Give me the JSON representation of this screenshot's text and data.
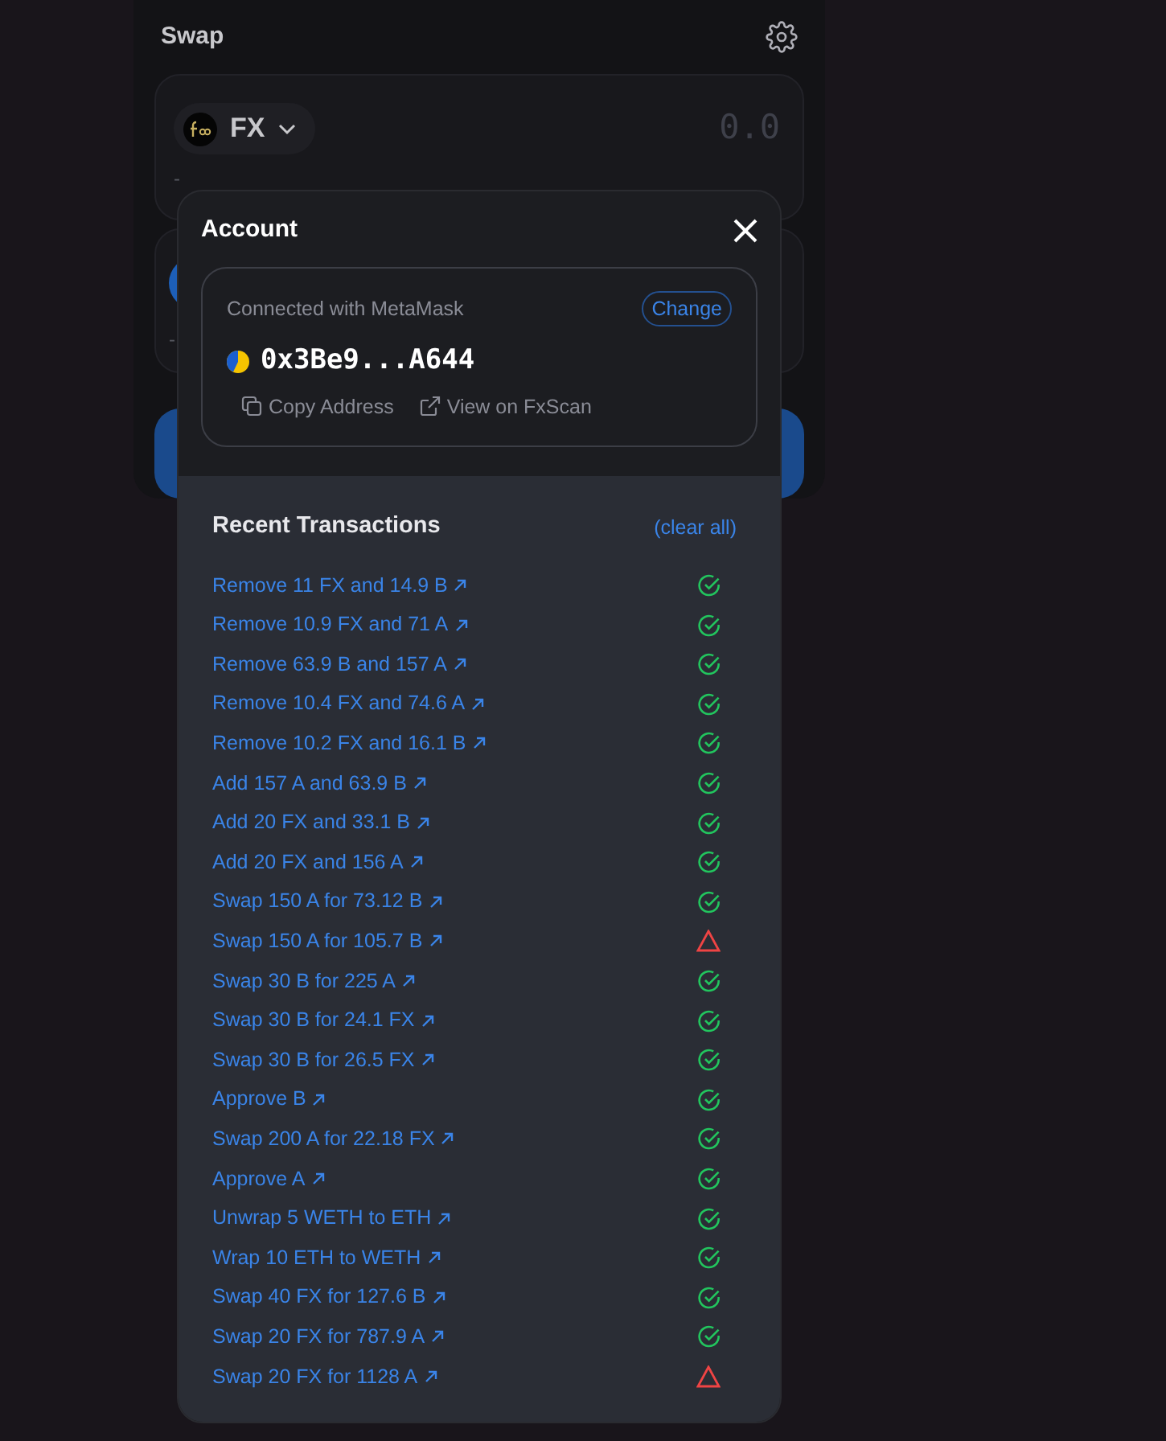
{
  "swap": {
    "title": "Swap",
    "input": {
      "token": "FX",
      "value": "0.0",
      "balance": "-"
    },
    "output": {
      "balance": "-"
    }
  },
  "account": {
    "title": "Account",
    "connected_with": "Connected with MetaMask",
    "change_label": "Change",
    "address": "0x3Be9...A644",
    "copy_label": "Copy Address",
    "explorer_label": "View on FxScan"
  },
  "transactions": {
    "title": "Recent Transactions",
    "clear_label": "(clear all)",
    "items": [
      {
        "label": "Remove 11 FX and 14.9 B",
        "failed": false
      },
      {
        "label": "Remove 10.9 FX and 71 A",
        "failed": false
      },
      {
        "label": "Remove 63.9 B and 157 A",
        "failed": false
      },
      {
        "label": "Remove 10.4 FX and 74.6 A",
        "failed": false
      },
      {
        "label": "Remove 10.2 FX and 16.1 B",
        "failed": false
      },
      {
        "label": "Add 157 A and 63.9 B",
        "failed": false
      },
      {
        "label": "Add 20 FX and 33.1 B",
        "failed": false
      },
      {
        "label": "Add 20 FX and 156 A",
        "failed": false
      },
      {
        "label": "Swap 150 A for 73.12 B",
        "failed": false
      },
      {
        "label": "Swap 150 A for 105.7 B",
        "failed": true
      },
      {
        "label": "Swap 30 B for 225 A",
        "failed": false
      },
      {
        "label": "Swap 30 B for 24.1 FX",
        "failed": false
      },
      {
        "label": "Swap 30 B for 26.5 FX",
        "failed": false
      },
      {
        "label": "Approve B",
        "failed": false
      },
      {
        "label": "Swap 200 A for 22.18 FX",
        "failed": false
      },
      {
        "label": "Approve A",
        "failed": false
      },
      {
        "label": "Unwrap 5 WETH to ETH",
        "failed": false
      },
      {
        "label": "Wrap 10 ETH to WETH",
        "failed": false
      },
      {
        "label": "Swap 40 FX for 127.6 B",
        "failed": false
      },
      {
        "label": "Swap 20 FX for 787.9 A",
        "failed": false
      },
      {
        "label": "Swap 20 FX for 1128 A",
        "failed": true
      }
    ]
  }
}
